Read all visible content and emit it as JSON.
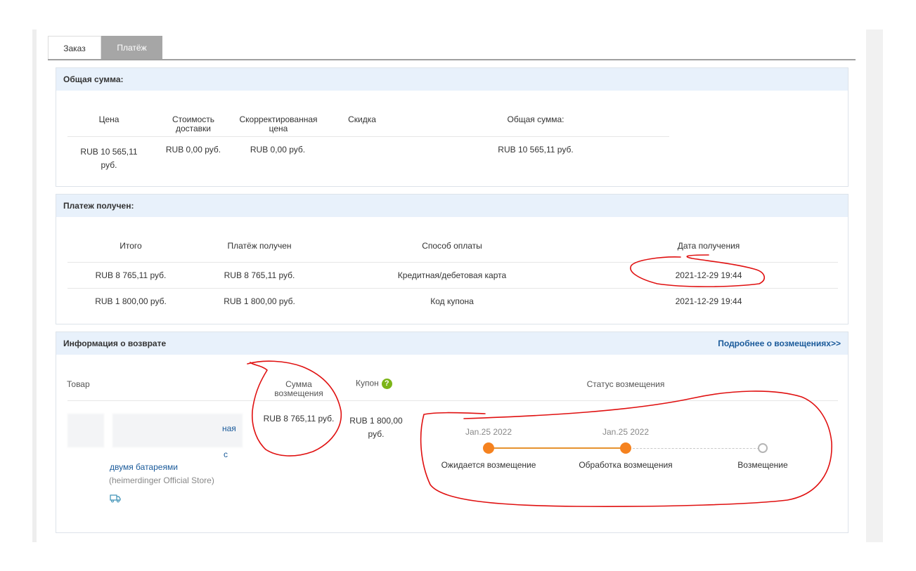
{
  "tabs": [
    {
      "label": "Заказ",
      "active": false
    },
    {
      "label": "Платёж",
      "active": true
    }
  ],
  "total_panel": {
    "title": "Общая сумма:",
    "headers": {
      "price": "Цена",
      "shipping_1": "Стоимость",
      "shipping_2": "доставки",
      "adjusted_1": "Скорректированная",
      "adjusted_2": "цена",
      "discount": "Скидка",
      "total": "Общая сумма:"
    },
    "row": {
      "price_1": "RUB 10 565,11",
      "price_2": "руб.",
      "shipping": "RUB 0,00 руб.",
      "adjusted": "RUB 0,00 руб.",
      "discount": "",
      "total": "RUB 10 565,11 руб."
    }
  },
  "payment_panel": {
    "title": "Платеж получен:",
    "headers": {
      "total": "Итого",
      "received": "Платёж получен",
      "method": "Способ оплаты",
      "date": "Дата получения"
    },
    "rows": [
      {
        "total": "RUB 8 765,11 руб.",
        "received": "RUB 8 765,11 руб.",
        "method": "Кредитная/дебетовая карта",
        "date": "2021-12-29 19:44"
      },
      {
        "total": "RUB 1 800,00 руб.",
        "received": "RUB 1 800,00 руб.",
        "method": "Код купона",
        "date": "2021-12-29 19:44"
      }
    ]
  },
  "refund_panel": {
    "title": "Информация о возврате",
    "more_link": "Подробнее о возмещениях>>",
    "headers": {
      "item": "Товар",
      "amount_1": "Сумма",
      "amount_2": "возмещения",
      "coupon": "Купон",
      "coupon_help": "?",
      "status": "Статус возмещения"
    },
    "item": {
      "partial_1": "ная",
      "partial_2": "с",
      "title_line": "двумя батареями",
      "store": "(heimerdinger Official Store)",
      "shipping_icon": "delivery-truck-icon"
    },
    "amount": "RUB 8 765,11 руб.",
    "coupon_1": "RUB 1 800,00",
    "coupon_2": "руб.",
    "timeline": {
      "steps": [
        {
          "date": "Jan.25 2022",
          "label": "Ожидается возмещение",
          "state": "done"
        },
        {
          "date": "Jan.25 2022",
          "label": "Обработка возмещения",
          "state": "current"
        },
        {
          "date": "",
          "label": "Возмещение",
          "state": "pending"
        }
      ],
      "colors": {
        "done": "#f5821f",
        "line": "#e6922f",
        "pending": "#b5b5b5"
      }
    }
  },
  "annotation_color": "#e01010"
}
